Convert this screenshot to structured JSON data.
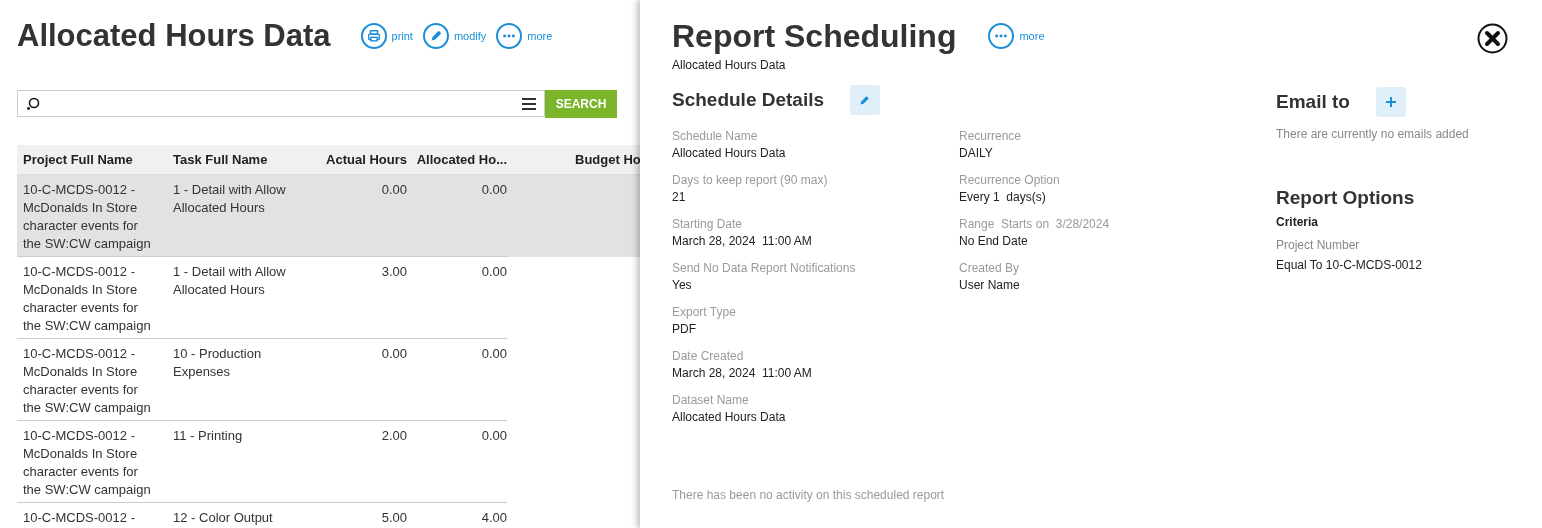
{
  "report": {
    "title": "Allocated Hours Data",
    "actions": [
      {
        "kind": "print",
        "label": "print"
      },
      {
        "kind": "modify",
        "label": "modify"
      },
      {
        "kind": "more",
        "label": "more"
      }
    ],
    "search": {
      "button": "SEARCH"
    },
    "table": {
      "columns": [
        {
          "label": "Project Full Name",
          "kind": "text"
        },
        {
          "label": "Task Full Name",
          "kind": "text"
        },
        {
          "label": "Actual Hours",
          "kind": "number"
        },
        {
          "label": "Allocated Ho...",
          "kind": "number"
        },
        {
          "label": "Budget Ho",
          "kind": "number"
        }
      ],
      "rows": [
        {
          "selected": true,
          "cells": [
            "10-C-MCDS-0012 - McDonalds In Store character events for the SW:CW campaign",
            "1 - Detail with Allow Allocated Hours",
            "0.00",
            "0.00"
          ]
        },
        {
          "selected": false,
          "cells": [
            "10-C-MCDS-0012 - McDonalds In Store character events for the SW:CW campaign",
            "1 - Detail with Allow Allocated Hours",
            "3.00",
            "0.00"
          ]
        },
        {
          "selected": false,
          "cells": [
            "10-C-MCDS-0012 - McDonalds In Store character events for the SW:CW campaign",
            "10 - Production Expenses",
            "0.00",
            "0.00"
          ]
        },
        {
          "selected": false,
          "cells": [
            "10-C-MCDS-0012 - McDonalds In Store character events for the SW:CW campaign",
            "11 - Printing",
            "2.00",
            "0.00"
          ]
        },
        {
          "selected": false,
          "cells": [
            "10-C-MCDS-0012 -",
            "12 - Color Output",
            "5.00",
            "4.00"
          ]
        }
      ]
    }
  },
  "panel": {
    "title": "Report Scheduling",
    "actions": [
      {
        "kind": "more",
        "label": "more"
      }
    ],
    "subtitle": "Allocated Hours Data",
    "schedule_details": {
      "heading": "Schedule Details",
      "columns": [
        [
          {
            "label": "Schedule Name",
            "value": "Allocated Hours Data"
          },
          {
            "label": "Days to keep report (90 max)",
            "value": "21"
          },
          {
            "label": "Starting Date",
            "value": "March 28, 2024  11:00 AM"
          },
          {
            "label": "Send No Data Report Notifications",
            "value": "Yes"
          },
          {
            "label": "Export Type",
            "value": "PDF"
          },
          {
            "label": "Date Created",
            "value": "March 28, 2024  11:00 AM"
          },
          {
            "label": "Dataset Name",
            "value": "Allocated Hours Data"
          }
        ],
        [
          {
            "label": "Recurrence",
            "value": "DAILY"
          },
          {
            "label": "Recurrence Option",
            "value": "Every 1  days(s)"
          },
          {
            "label": "Range  Starts on  3/28/2024",
            "value": "No End Date"
          },
          {
            "label": "Created By",
            "value": "User Name"
          }
        ]
      ]
    },
    "activity_note": "There has been no activity on this scheduled report",
    "email": {
      "heading": "Email to",
      "empty_note": "There are currently no emails added"
    },
    "report_options": {
      "heading": "Report Options",
      "criteria_heading": "Criteria",
      "criteria": [
        {
          "label": "Project Number",
          "value": "Equal To 10-C-MCDS-0012"
        }
      ]
    }
  }
}
